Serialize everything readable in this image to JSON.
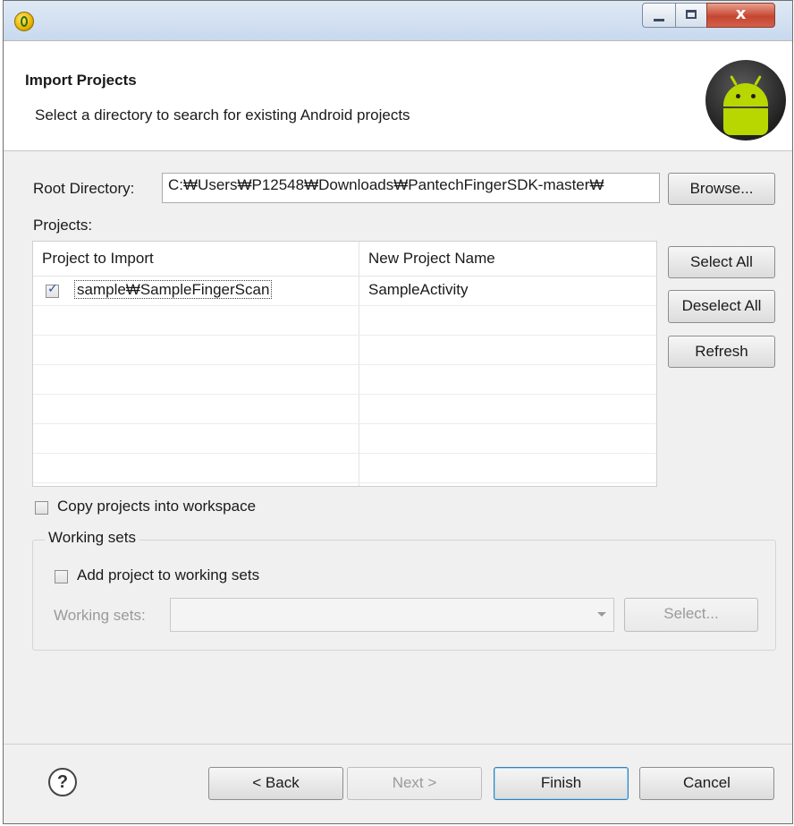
{
  "window": {
    "app_icon": "eclipse-adt-icon",
    "controls": {
      "minimize": "minimize-icon",
      "maximize": "maximize-icon",
      "close_label": "x"
    }
  },
  "banner": {
    "title": "Import Projects",
    "description": "Select a directory to search for existing Android projects",
    "logo": "android-logo"
  },
  "root_directory": {
    "label": "Root Directory:",
    "value": "C:\\Users\\P12548\\Downloads\\PantechFingerSDK-master\\",
    "display_value": "C:₩Users₩P12548₩Downloads₩PantechFingerSDK-master₩",
    "browse_label": "Browse..."
  },
  "projects": {
    "label": "Projects:",
    "columns": [
      "Project to Import",
      "New Project Name"
    ],
    "rows": [
      {
        "checked": true,
        "project": "sample₩SampleFingerScan",
        "new_name": "SampleActivity"
      }
    ],
    "buttons": {
      "select_all": "Select All",
      "deselect_all": "Deselect All",
      "refresh": "Refresh"
    }
  },
  "copy_option": {
    "label": "Copy projects into workspace",
    "checked": false
  },
  "working_sets": {
    "group_title": "Working sets",
    "add_label": "Add project to working sets",
    "add_checked": false,
    "sets_label": "Working sets:",
    "select_label": "Select..."
  },
  "footer": {
    "help_icon": "help-icon",
    "back_label": "< Back",
    "next_label": "Next >",
    "finish_label": "Finish",
    "cancel_label": "Cancel"
  }
}
